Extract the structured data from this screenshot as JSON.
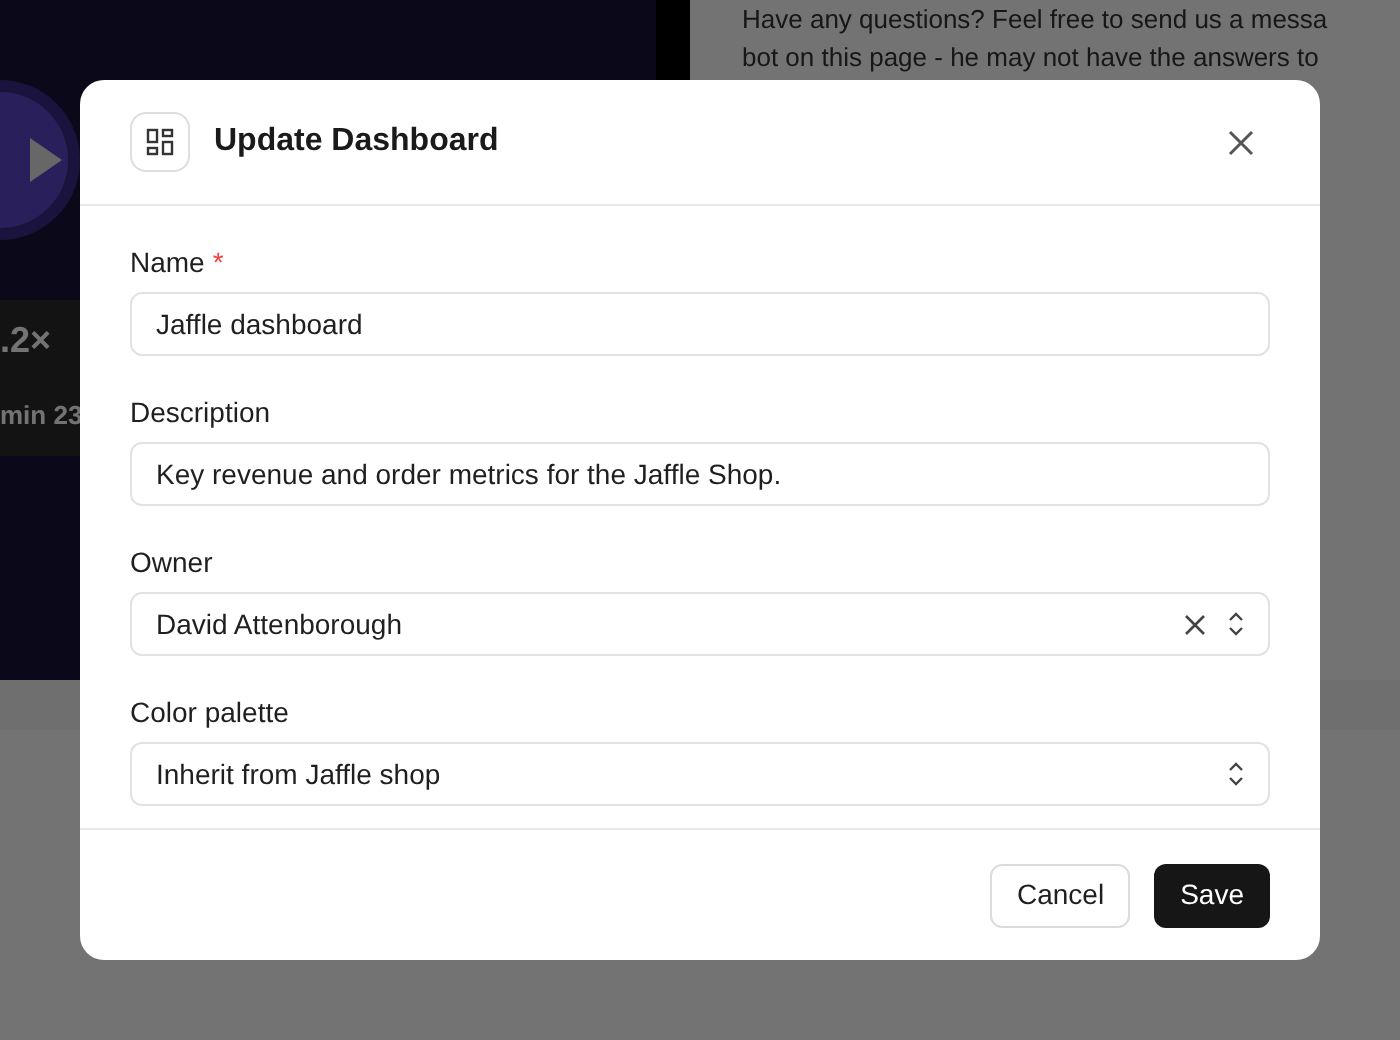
{
  "background": {
    "video": {
      "speed": ".2×",
      "duration": "min 23"
    },
    "help_text": [
      "Have any questions? Feel free to send us a messa",
      "bot on this page - he may not have the answers to"
    ]
  },
  "dialog": {
    "title": "Update Dashboard",
    "fields": [
      {
        "kind": "text",
        "label": "Name",
        "required_mark": "*",
        "value": "Jaffle dashboard"
      },
      {
        "kind": "text",
        "label": "Description",
        "value": "Key revenue and order metrics for the Jaffle Shop."
      },
      {
        "kind": "select",
        "label": "Owner",
        "value": "David Attenborough",
        "clearable": true
      },
      {
        "kind": "select",
        "label": "Color palette",
        "value": "Inherit from Jaffle shop",
        "clearable": false
      }
    ],
    "buttons": [
      {
        "label": "Cancel",
        "primary": false
      },
      {
        "label": "Save",
        "primary": true
      }
    ]
  }
}
